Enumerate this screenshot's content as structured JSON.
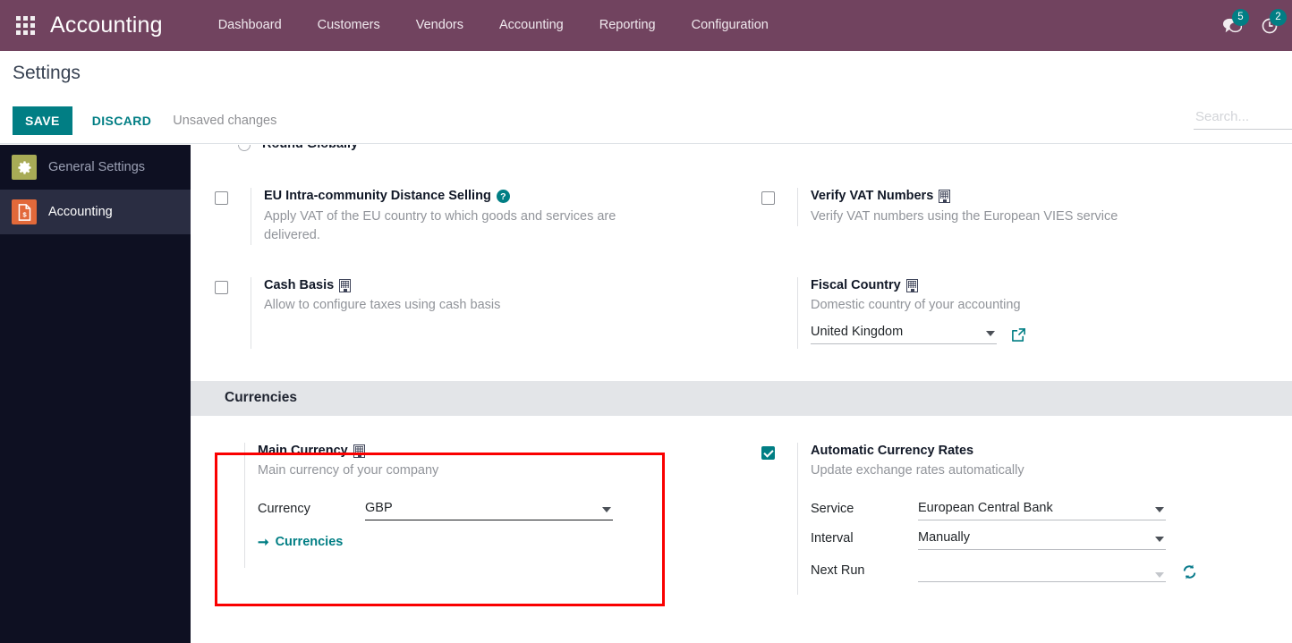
{
  "navbar": {
    "apps_icon": "apps-grid-icon",
    "brand": "Accounting",
    "menu": [
      {
        "label": "Dashboard"
      },
      {
        "label": "Customers"
      },
      {
        "label": "Vendors"
      },
      {
        "label": "Accounting"
      },
      {
        "label": "Reporting"
      },
      {
        "label": "Configuration"
      }
    ],
    "systray": [
      {
        "icon": "messages-icon",
        "count": "5"
      },
      {
        "icon": "activities-clock-icon",
        "count": "2"
      }
    ],
    "bg_color": "#71435f"
  },
  "control_panel": {
    "title": "Settings",
    "save_label": "SAVE",
    "discard_label": "DISCARD",
    "status_text": "Unsaved changes",
    "accent_color": "#017e84",
    "search": {
      "placeholder": "Search...",
      "value": ""
    }
  },
  "sidebar": {
    "items": [
      {
        "label": "General Settings",
        "icon": "gear-icon",
        "icon_color": "#a8ab56",
        "active": false
      },
      {
        "label": "Accounting",
        "icon": "invoice-document-icon",
        "icon_color": "#e2693a",
        "active": true
      }
    ]
  },
  "settings": {
    "rounding_partial": {
      "label": "Round Globally"
    },
    "eu_distance_selling": {
      "title": "EU Intra-community Distance Selling",
      "desc": "Apply VAT of the EU country to which goods and services are delivered.",
      "help_icon": "question-mark-icon",
      "checked": false
    },
    "verify_vat": {
      "title": "Verify VAT Numbers",
      "desc": "Verify VAT numbers using the European VIES service",
      "company_icon": "building-icon",
      "checked": false
    },
    "cash_basis": {
      "title": "Cash Basis",
      "desc": "Allow to configure taxes using cash basis",
      "company_icon": "building-icon",
      "checked": false
    },
    "fiscal_country": {
      "title": "Fiscal Country",
      "desc": "Domestic country of your accounting",
      "company_icon": "building-icon",
      "value": "United Kingdom",
      "external_link_icon": "external-link-icon"
    }
  },
  "currencies_section": {
    "header": "Currencies",
    "main_currency": {
      "title": "Main Currency",
      "desc": "Main currency of your company",
      "company_icon": "building-icon",
      "field_label": "Currency",
      "field_value": "GBP",
      "link_label": "Currencies",
      "link_arrow_icon": "arrow-right-icon",
      "highlighted": true,
      "highlight_color": "#fa0000"
    },
    "automatic_rates": {
      "title": "Automatic Currency Rates",
      "desc": "Update exchange rates automatically",
      "checked": true,
      "fields": [
        {
          "label": "Service",
          "value": "European Central Bank"
        },
        {
          "label": "Interval",
          "value": "Manually"
        },
        {
          "label": "Next Run",
          "value": ""
        }
      ],
      "refresh_icon": "refresh-sync-icon"
    }
  }
}
